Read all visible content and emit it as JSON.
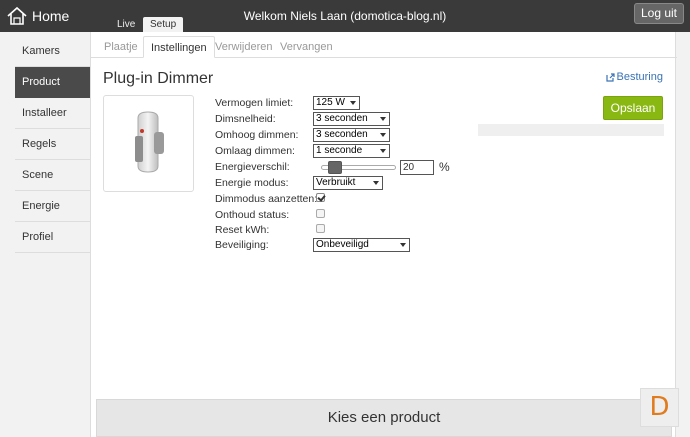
{
  "header": {
    "home_label": "Home",
    "tabs": [
      {
        "label": "Live"
      },
      {
        "label": "Setup"
      }
    ],
    "welcome": "Welkom Niels Laan (domotica-blog.nl)",
    "logout_label": "Log uit"
  },
  "sidebar": {
    "items": [
      {
        "label": "Kamers"
      },
      {
        "label": "Product"
      },
      {
        "label": "Installeer"
      },
      {
        "label": "Regels"
      },
      {
        "label": "Scene"
      },
      {
        "label": "Energie"
      },
      {
        "label": "Profiel"
      }
    ],
    "active": "Product"
  },
  "subtabs": [
    {
      "label": "Plaatje"
    },
    {
      "label": "Instellingen"
    },
    {
      "label": "Verwijderen"
    },
    {
      "label": "Vervangen"
    }
  ],
  "device": {
    "title": "Plug-in Dimmer",
    "control_link": "Besturing",
    "save_label": "Opslaan"
  },
  "settings": {
    "power_limit": {
      "label": "Vermogen limiet:",
      "value": "125 W"
    },
    "dim_speed": {
      "label": "Dimsnelheid:",
      "value": "3 seconden"
    },
    "dim_up": {
      "label": "Omhoog dimmen:",
      "value": "3 seconden"
    },
    "dim_down": {
      "label": "Omlaag dimmen:",
      "value": "1 seconde"
    },
    "energy_diff": {
      "label": "Energieverschil:",
      "value": "20",
      "unit": "%",
      "slider_fraction": 0.1
    },
    "energy_mode": {
      "label": "Energie modus:",
      "value": "Verbruikt"
    },
    "dim_mode": {
      "label": "Dimmodus aanzetten:",
      "checked": true
    },
    "remember_status": {
      "label": "Onthoud status:",
      "checked": false
    },
    "reset_kwh": {
      "label": "Reset kWh:",
      "checked": false
    },
    "security": {
      "label": "Beveiliging:",
      "value": "Onbeveiligd"
    }
  },
  "footer": {
    "label": "Kies een product"
  },
  "logo": {
    "letter": "D"
  },
  "colors": {
    "accent": "#8ab812",
    "topbar": "#3a3a3a",
    "link": "#3a73b5",
    "logo": "#e07b1e"
  }
}
